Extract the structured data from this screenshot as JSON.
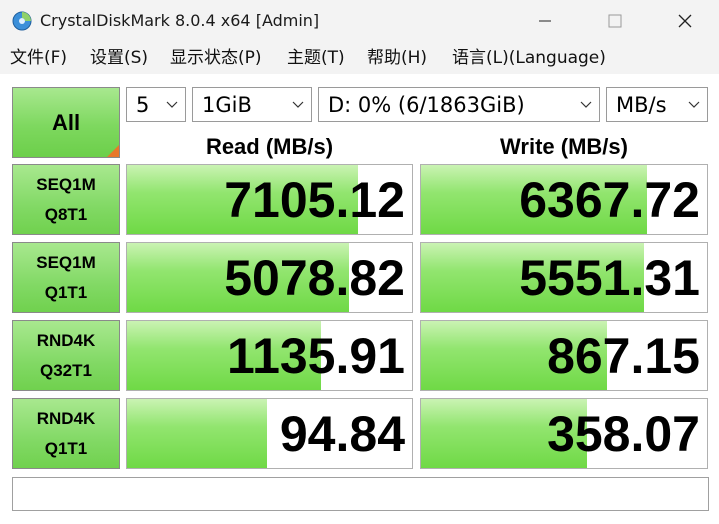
{
  "window": {
    "title": "CrystalDiskMark 8.0.4 x64 [Admin]",
    "icon": "app-disk-icon",
    "controls": [
      "minimize-icon",
      "maximize-icon",
      "close-icon"
    ]
  },
  "menu": [
    {
      "label": "文件(F)"
    },
    {
      "label": "设置(S)"
    },
    {
      "label": "显示状态(P)"
    },
    {
      "label": "主题(T)"
    },
    {
      "label": "帮助(H)"
    },
    {
      "label": "语言(L)(Language)"
    }
  ],
  "controls": {
    "all_label": "All",
    "count": "5",
    "size": "1GiB",
    "drive": "D: 0% (6/1863GiB)",
    "unit": "MB/s"
  },
  "headers": {
    "read": "Read (MB/s)",
    "write": "Write (MB/s)"
  },
  "tests": [
    {
      "line1": "SEQ1M",
      "line2": "Q8T1",
      "read": "7105.12",
      "write": "6367.72",
      "read_fill": 0.81,
      "write_fill": 0.79
    },
    {
      "line1": "SEQ1M",
      "line2": "Q1T1",
      "read": "5078.82",
      "write": "5551.31",
      "read_fill": 0.78,
      "write_fill": 0.78
    },
    {
      "line1": "RND4K",
      "line2": "Q32T1",
      "read": "1135.91",
      "write": "867.15",
      "read_fill": 0.68,
      "write_fill": 0.65
    },
    {
      "line1": "RND4K",
      "line2": "Q1T1",
      "read": "94.84",
      "write": "358.07",
      "read_fill": 0.49,
      "write_fill": 0.58
    }
  ],
  "comment": "",
  "colors": {
    "bar_green": "#6fd946",
    "button_green": "#7ed85f",
    "corner_orange": "#e8782a"
  }
}
